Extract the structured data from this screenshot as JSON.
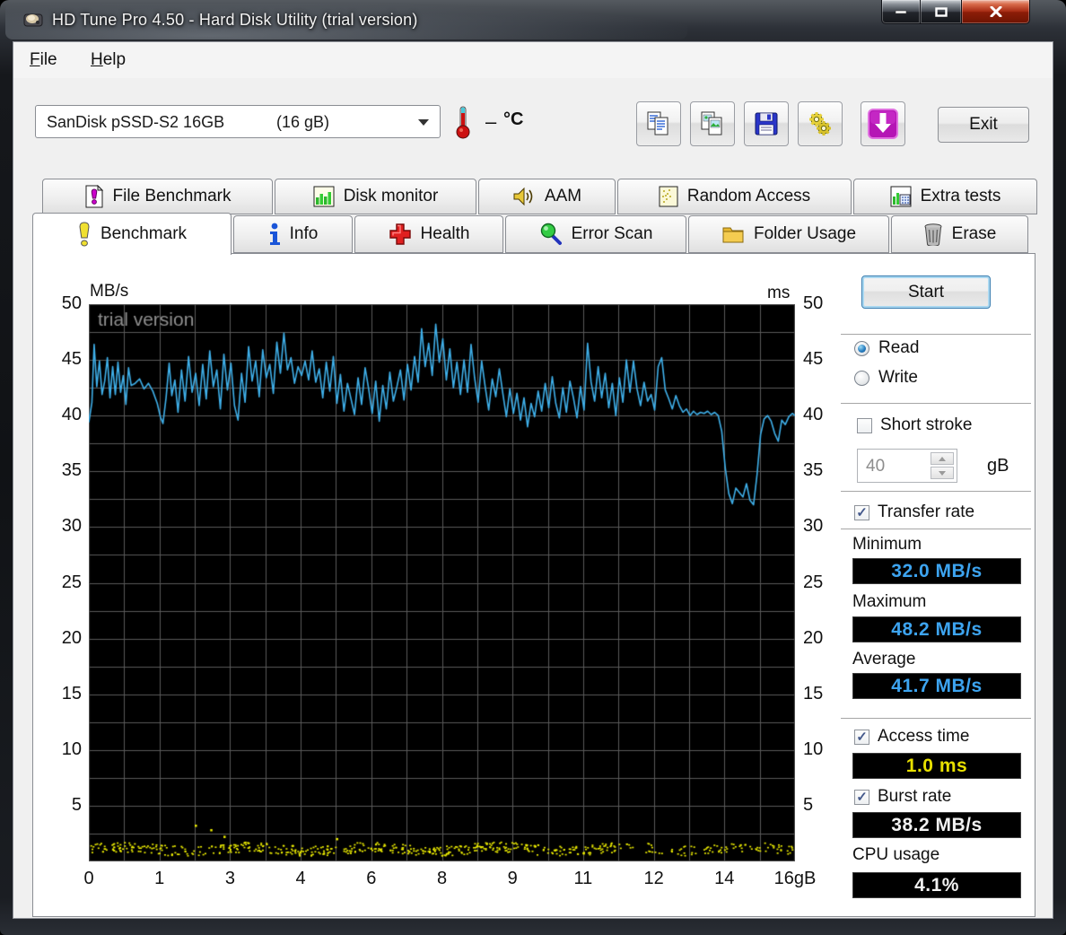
{
  "window": {
    "title": "HD Tune Pro 4.50 - Hard Disk Utility (trial version)",
    "controls": {
      "minimize": "minimize",
      "maximize": "maximize",
      "close": "close"
    }
  },
  "menu": {
    "file": {
      "initial": "F",
      "rest": "ile"
    },
    "help": {
      "initial": "H",
      "rest": "elp"
    }
  },
  "toolbar": {
    "drive_name": "SanDisk pSSD-S2 16GB",
    "drive_capacity": "(16 gB)",
    "temperature_dash": "–",
    "temperature_unit": "°C",
    "icons": [
      "thermometer-icon",
      "copy-icon",
      "copy-image-icon",
      "save-icon",
      "options-icon",
      "download-icon"
    ],
    "exit_label": "Exit"
  },
  "tabs_row1": [
    {
      "label": "File Benchmark",
      "icon": "file-benchmark-icon"
    },
    {
      "label": "Disk monitor",
      "icon": "disk-monitor-icon"
    },
    {
      "label": "AAM",
      "icon": "speaker-icon"
    },
    {
      "label": "Random Access",
      "icon": "random-access-icon"
    },
    {
      "label": "Extra tests",
      "icon": "extra-tests-icon"
    }
  ],
  "tabs_row2": [
    {
      "label": "Benchmark",
      "icon": "benchmark-icon",
      "active": true
    },
    {
      "label": "Info",
      "icon": "info-icon"
    },
    {
      "label": "Health",
      "icon": "health-icon"
    },
    {
      "label": "Error Scan",
      "icon": "magnifier-icon"
    },
    {
      "label": "Folder Usage",
      "icon": "folder-icon"
    },
    {
      "label": "Erase",
      "icon": "trash-icon"
    }
  ],
  "controls": {
    "start_label": "Start",
    "read_label": "Read",
    "write_label": "Write",
    "read_selected": true,
    "short_stroke_label": "Short stroke",
    "short_stroke_checked": false,
    "stroke_value": "40",
    "stroke_unit": "gB",
    "transfer_rate_label": "Transfer rate",
    "transfer_rate_checked": true,
    "check_glyph": "✓",
    "minimum_label": "Minimum",
    "minimum_value": "32.0 MB/s",
    "maximum_label": "Maximum",
    "maximum_value": "48.2 MB/s",
    "average_label": "Average",
    "average_value": "41.7 MB/s",
    "access_time_label": "Access time",
    "access_time_checked": true,
    "access_time_value": "1.0 ms",
    "burst_rate_label": "Burst rate",
    "burst_rate_checked": true,
    "burst_rate_value": "38.2 MB/s",
    "cpu_usage_label": "CPU usage",
    "cpu_usage_value": "4.1%"
  },
  "chart_data": {
    "type": "line",
    "annotation": "trial version",
    "y_left_label": "MB/s",
    "y_right_label": "ms",
    "ylim": [
      0,
      50
    ],
    "y_ticks": [
      50,
      45,
      40,
      35,
      30,
      25,
      20,
      15,
      10,
      5
    ],
    "x_tick_labels": [
      "0",
      "1",
      "3",
      "4",
      "6",
      "8",
      "9",
      "11",
      "12",
      "14",
      "16gB"
    ],
    "xlim_gb": [
      0,
      16
    ],
    "grid_divisions_x": 20,
    "grid_divisions_y": 20,
    "grid_color": "#5a5a5a",
    "background": "#000000",
    "series": [
      {
        "name": "transfer_rate",
        "unit": "MB/s",
        "color": "#3fb0ea",
        "points": [
          [
            0,
            39.4
          ],
          [
            0.07,
            41.2
          ],
          [
            0.12,
            46.4
          ],
          [
            0.18,
            42.6
          ],
          [
            0.24,
            44.9
          ],
          [
            0.3,
            41.9
          ],
          [
            0.36,
            43.1
          ],
          [
            0.42,
            45.2
          ],
          [
            0.48,
            41.6
          ],
          [
            0.54,
            44.4
          ],
          [
            0.6,
            41.9
          ],
          [
            0.66,
            44.8
          ],
          [
            0.72,
            42.1
          ],
          [
            0.78,
            43.6
          ],
          [
            0.84,
            41.0
          ],
          [
            0.9,
            44.3
          ],
          [
            0.96,
            42.7
          ],
          [
            1.05,
            42.9
          ],
          [
            1.15,
            43.3
          ],
          [
            1.25,
            42.4
          ],
          [
            1.35,
            42.9
          ],
          [
            1.45,
            42.2
          ],
          [
            1.55,
            41.1
          ],
          [
            1.62,
            39.9
          ],
          [
            1.68,
            39.3
          ],
          [
            1.75,
            41.6
          ],
          [
            1.82,
            44.7
          ],
          [
            1.88,
            41.8
          ],
          [
            1.95,
            43.2
          ],
          [
            2.02,
            40.3
          ],
          [
            2.1,
            44.1
          ],
          [
            2.18,
            41.3
          ],
          [
            2.26,
            45.3
          ],
          [
            2.34,
            42.1
          ],
          [
            2.42,
            43.8
          ],
          [
            2.5,
            40.9
          ],
          [
            2.58,
            44.6
          ],
          [
            2.66,
            41.5
          ],
          [
            2.74,
            45.8
          ],
          [
            2.82,
            42.6
          ],
          [
            2.9,
            44.1
          ],
          [
            2.98,
            40.6
          ],
          [
            3.06,
            45.5
          ],
          [
            3.14,
            42.3
          ],
          [
            3.22,
            44.7
          ],
          [
            3.3,
            40.9
          ],
          [
            3.38,
            39.6
          ],
          [
            3.46,
            43.8
          ],
          [
            3.54,
            41.2
          ],
          [
            3.62,
            46.2
          ],
          [
            3.7,
            43.1
          ],
          [
            3.78,
            44.9
          ],
          [
            3.86,
            41.7
          ],
          [
            3.94,
            45.9
          ],
          [
            4.02,
            43.4
          ],
          [
            4.1,
            44.6
          ],
          [
            4.18,
            42.0
          ],
          [
            4.26,
            46.6
          ],
          [
            4.34,
            43.8
          ],
          [
            4.42,
            47.4
          ],
          [
            4.5,
            44.1
          ],
          [
            4.58,
            45.2
          ],
          [
            4.66,
            42.9
          ],
          [
            4.74,
            44.4
          ],
          [
            4.82,
            43.6
          ],
          [
            4.9,
            44.9
          ],
          [
            4.98,
            43.2
          ],
          [
            5.06,
            45.8
          ],
          [
            5.14,
            43.0
          ],
          [
            5.22,
            44.2
          ],
          [
            5.3,
            41.6
          ],
          [
            5.38,
            44.8
          ],
          [
            5.46,
            42.2
          ],
          [
            5.54,
            45.3
          ],
          [
            5.62,
            41.1
          ],
          [
            5.7,
            43.7
          ],
          [
            5.78,
            40.4
          ],
          [
            5.86,
            42.9
          ],
          [
            5.94,
            41.5
          ],
          [
            6.02,
            40.1
          ],
          [
            6.1,
            43.4
          ],
          [
            6.18,
            41.0
          ],
          [
            6.26,
            44.3
          ],
          [
            6.34,
            42.4
          ],
          [
            6.42,
            40.2
          ],
          [
            6.5,
            43.1
          ],
          [
            6.58,
            39.5
          ],
          [
            6.66,
            42.7
          ],
          [
            6.74,
            40.6
          ],
          [
            6.82,
            43.9
          ],
          [
            6.9,
            41.3
          ],
          [
            6.98,
            42.6
          ],
          [
            7.06,
            44.1
          ],
          [
            7.14,
            41.4
          ],
          [
            7.22,
            44.6
          ],
          [
            7.3,
            42.3
          ],
          [
            7.38,
            45.3
          ],
          [
            7.46,
            43.0
          ],
          [
            7.54,
            47.8
          ],
          [
            7.62,
            44.4
          ],
          [
            7.7,
            46.5
          ],
          [
            7.78,
            43.6
          ],
          [
            7.86,
            48.2
          ],
          [
            7.94,
            44.8
          ],
          [
            8.02,
            46.9
          ],
          [
            8.1,
            43.2
          ],
          [
            8.18,
            46.0
          ],
          [
            8.26,
            42.5
          ],
          [
            8.34,
            44.8
          ],
          [
            8.42,
            41.9
          ],
          [
            8.5,
            45.0
          ],
          [
            8.58,
            42.1
          ],
          [
            8.66,
            46.4
          ],
          [
            8.74,
            43.4
          ],
          [
            8.82,
            41.2
          ],
          [
            8.9,
            44.9
          ],
          [
            8.98,
            42.6
          ],
          [
            9.06,
            40.5
          ],
          [
            9.14,
            43.3
          ],
          [
            9.22,
            41.7
          ],
          [
            9.3,
            44.2
          ],
          [
            9.38,
            42.0
          ],
          [
            9.46,
            39.9
          ],
          [
            9.54,
            42.4
          ],
          [
            9.62,
            40.2
          ],
          [
            9.7,
            42.0
          ],
          [
            9.78,
            39.6
          ],
          [
            9.86,
            41.6
          ],
          [
            9.94,
            39.0
          ],
          [
            10.02,
            41.1
          ],
          [
            10.1,
            39.9
          ],
          [
            10.18,
            42.2
          ],
          [
            10.26,
            40.4
          ],
          [
            10.34,
            42.9
          ],
          [
            10.42,
            40.7
          ],
          [
            10.5,
            43.5
          ],
          [
            10.58,
            41.1
          ],
          [
            10.66,
            39.8
          ],
          [
            10.74,
            42.5
          ],
          [
            10.82,
            40.3
          ],
          [
            10.9,
            43.1
          ],
          [
            10.98,
            41.6
          ],
          [
            11.06,
            39.8
          ],
          [
            11.14,
            42.6
          ],
          [
            11.22,
            40.5
          ],
          [
            11.3,
            46.5
          ],
          [
            11.38,
            43.0
          ],
          [
            11.46,
            41.3
          ],
          [
            11.54,
            44.4
          ],
          [
            11.62,
            41.6
          ],
          [
            11.7,
            43.8
          ],
          [
            11.78,
            40.7
          ],
          [
            11.86,
            42.9
          ],
          [
            11.94,
            40.0
          ],
          [
            12.02,
            43.4
          ],
          [
            12.1,
            41.2
          ],
          [
            12.18,
            45.0
          ],
          [
            12.26,
            42.1
          ],
          [
            12.34,
            44.9
          ],
          [
            12.42,
            42.4
          ],
          [
            12.5,
            40.9
          ],
          [
            12.58,
            43.0
          ],
          [
            12.66,
            41.3
          ],
          [
            12.74,
            41.9
          ],
          [
            12.82,
            40.5
          ],
          [
            12.9,
            44.4
          ],
          [
            12.98,
            45.2
          ],
          [
            13.06,
            42.3
          ],
          [
            13.14,
            41.5
          ],
          [
            13.22,
            40.6
          ],
          [
            13.3,
            41.8
          ],
          [
            13.38,
            40.9
          ],
          [
            13.46,
            40.3
          ],
          [
            13.54,
            40.6
          ],
          [
            13.62,
            40.0
          ],
          [
            13.7,
            40.4
          ],
          [
            13.78,
            40.1
          ],
          [
            13.86,
            40.3
          ],
          [
            13.94,
            40.2
          ],
          [
            14.02,
            40.4
          ],
          [
            14.1,
            40.1
          ],
          [
            14.18,
            40.3
          ],
          [
            14.26,
            40.0
          ],
          [
            14.34,
            38.6
          ],
          [
            14.42,
            35.3
          ],
          [
            14.5,
            33.0
          ],
          [
            14.58,
            32.1
          ],
          [
            14.66,
            33.5
          ],
          [
            14.74,
            33.1
          ],
          [
            14.82,
            32.7
          ],
          [
            14.9,
            33.9
          ],
          [
            14.98,
            32.4
          ],
          [
            15.06,
            32.0
          ],
          [
            15.14,
            34.7
          ],
          [
            15.22,
            38.3
          ],
          [
            15.3,
            39.7
          ],
          [
            15.38,
            40.0
          ],
          [
            15.46,
            39.5
          ],
          [
            15.54,
            38.4
          ],
          [
            15.62,
            37.7
          ],
          [
            15.7,
            39.6
          ],
          [
            15.78,
            39.2
          ],
          [
            15.86,
            39.9
          ],
          [
            15.94,
            40.2
          ],
          [
            16,
            40.0
          ]
        ]
      },
      {
        "name": "access_time",
        "unit": "ms",
        "color": "#f0f000",
        "band_y_ms": [
          0.7,
          1.6
        ],
        "dot_count": 660,
        "outliers": [
          [
            2.75,
            2.9
          ],
          [
            3.05,
            2.3
          ],
          [
            2.4,
            3.3
          ],
          [
            5.6,
            2.1
          ]
        ]
      }
    ]
  }
}
